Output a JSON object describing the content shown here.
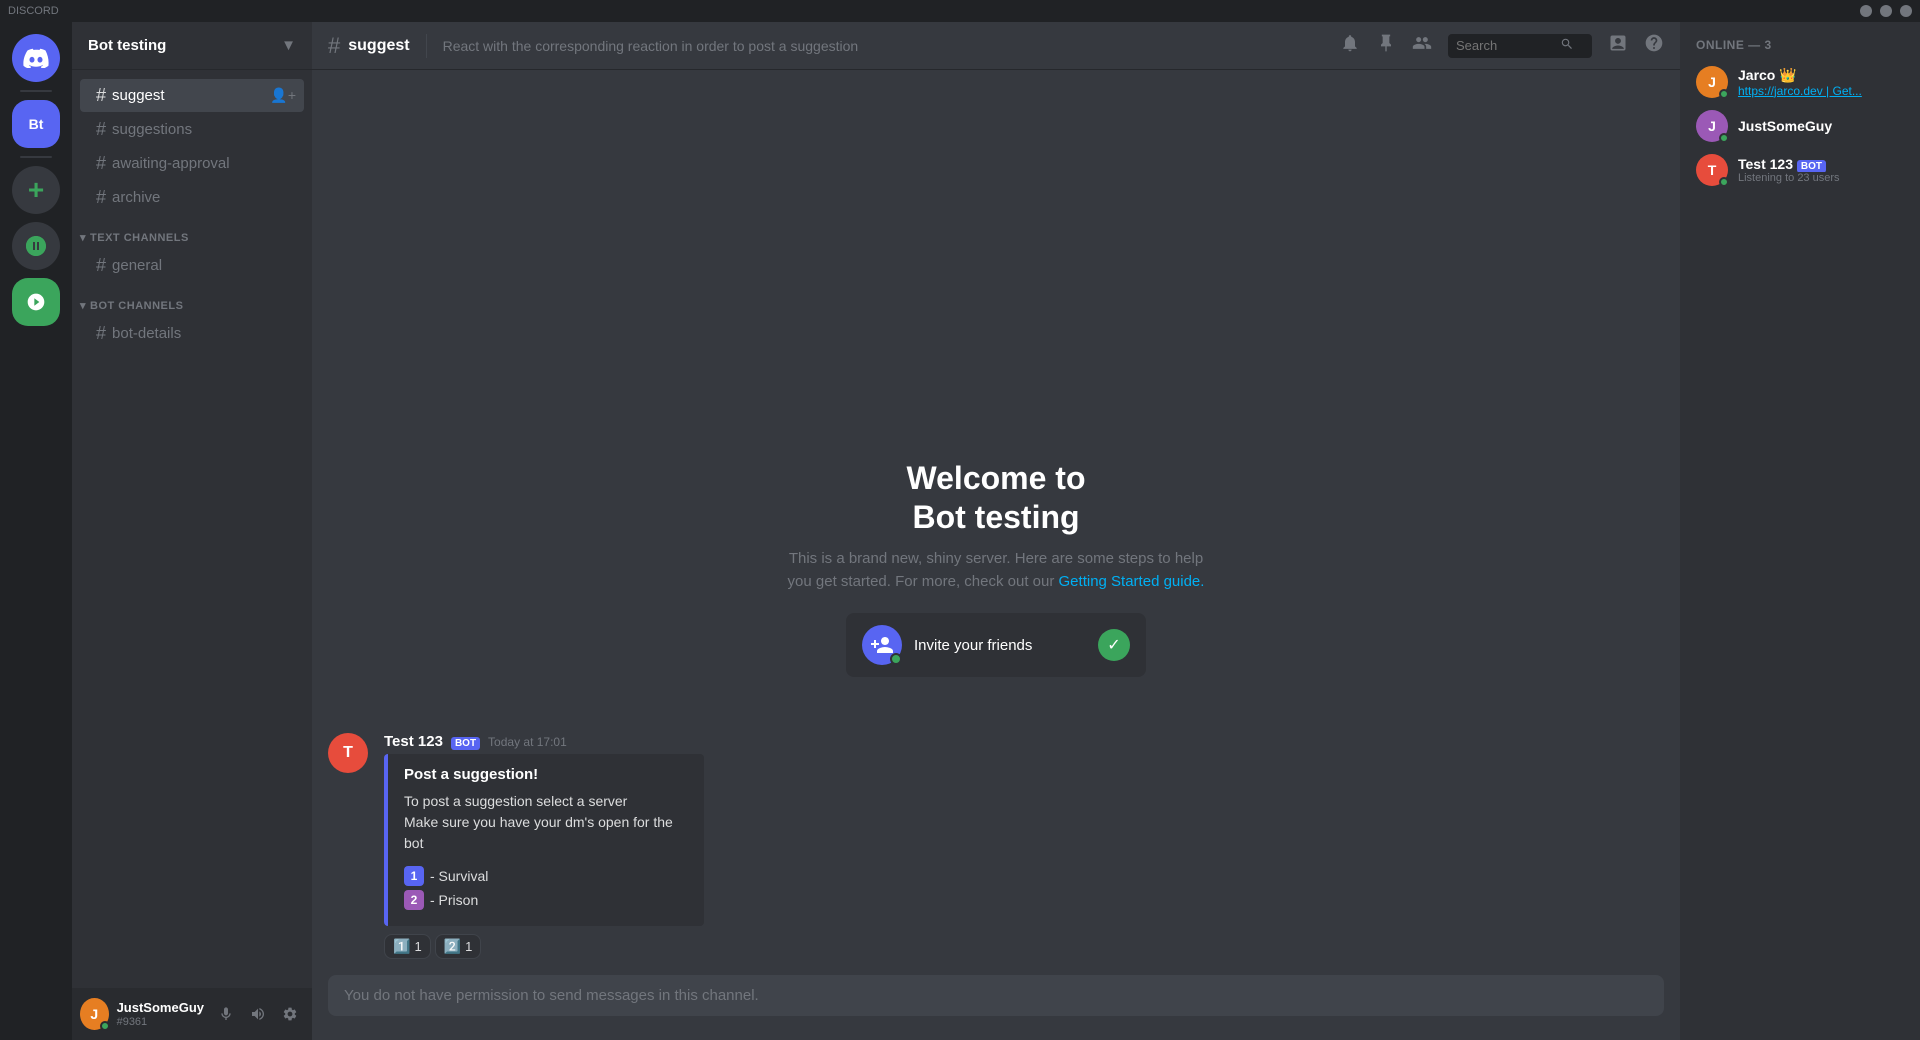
{
  "app": {
    "title": "DISCORD"
  },
  "titlebar": {
    "min": "—",
    "max": "□",
    "close": "✕"
  },
  "servers": [
    {
      "id": "discord-home",
      "label": "Discord Home",
      "icon": "🎮",
      "type": "discord"
    },
    {
      "id": "bt-server",
      "label": "Bot testing",
      "initials": "Bt",
      "type": "purple",
      "active": true
    }
  ],
  "sidebar": {
    "server_name": "Bot testing",
    "categories": [
      {
        "id": "suggestion-channels",
        "label": "",
        "channels": [
          {
            "id": "suggest",
            "name": "suggest",
            "active": true,
            "has_invite": true
          },
          {
            "id": "suggestions",
            "name": "suggestions",
            "active": false
          },
          {
            "id": "awaiting-approval",
            "name": "awaiting-approval",
            "active": false
          },
          {
            "id": "archive",
            "name": "archive",
            "active": false
          }
        ]
      },
      {
        "id": "text-channels",
        "label": "TEXT CHANNELS",
        "channels": [
          {
            "id": "general",
            "name": "general",
            "active": false
          }
        ]
      },
      {
        "id": "bot-channels",
        "label": "BOT CHANNELS",
        "channels": [
          {
            "id": "bot-details",
            "name": "bot-details",
            "active": false
          }
        ]
      }
    ]
  },
  "channel_header": {
    "hash": "#",
    "name": "suggest",
    "description": "React with the corresponding reaction in order to post a suggestion"
  },
  "header_icons": {
    "bell": "🔔",
    "pin": "📌",
    "members": "👥",
    "search_placeholder": "Search",
    "inbox": "📥",
    "help": "?"
  },
  "welcome": {
    "title_line1": "Welcome to",
    "title_line2": "Bot testing",
    "description": "This is a brand new, shiny server. Here are some steps to help you get started. For more, check out our",
    "link_text": "Getting Started guide.",
    "invite_text": "Invite your friends"
  },
  "message": {
    "author": "Test 123",
    "author_badge": "BOT",
    "timestamp": "Today at 17:01",
    "embed": {
      "title": "Post a suggestion!",
      "description_line1": "To post a suggestion select a server",
      "description_line2": "Make sure you have your dm's open for the bot",
      "items": [
        {
          "num": "1",
          "color": "blue",
          "text": "- Survival"
        },
        {
          "num": "2",
          "color": "purple",
          "text": "- Prison"
        }
      ]
    },
    "reactions": [
      {
        "emoji": "1️⃣",
        "count": "1"
      },
      {
        "emoji": "2️⃣",
        "count": "1"
      }
    ]
  },
  "input_bar": {
    "placeholder": "You do not have permission to send messages in this channel."
  },
  "right_sidebar": {
    "online_header": "ONLINE — 3",
    "users": [
      {
        "id": "jarco",
        "name": "Jarco",
        "crown": true,
        "sub": "https://jarco.dev | Get...",
        "avatar_color": "#e67e22",
        "initials": "J"
      },
      {
        "id": "justsomeguy",
        "name": "JustSomeGuy",
        "crown": false,
        "sub": "",
        "avatar_color": "#9b59b6",
        "initials": "J"
      },
      {
        "id": "test123",
        "name": "Test 123",
        "is_bot": true,
        "sub": "Listening to 23 users",
        "avatar_color": "#e74c3c",
        "initials": "T"
      }
    ]
  },
  "user_panel": {
    "name": "JustSomeGuy",
    "tag": "#9361",
    "avatar_color": "#e67e22",
    "initials": "J"
  }
}
